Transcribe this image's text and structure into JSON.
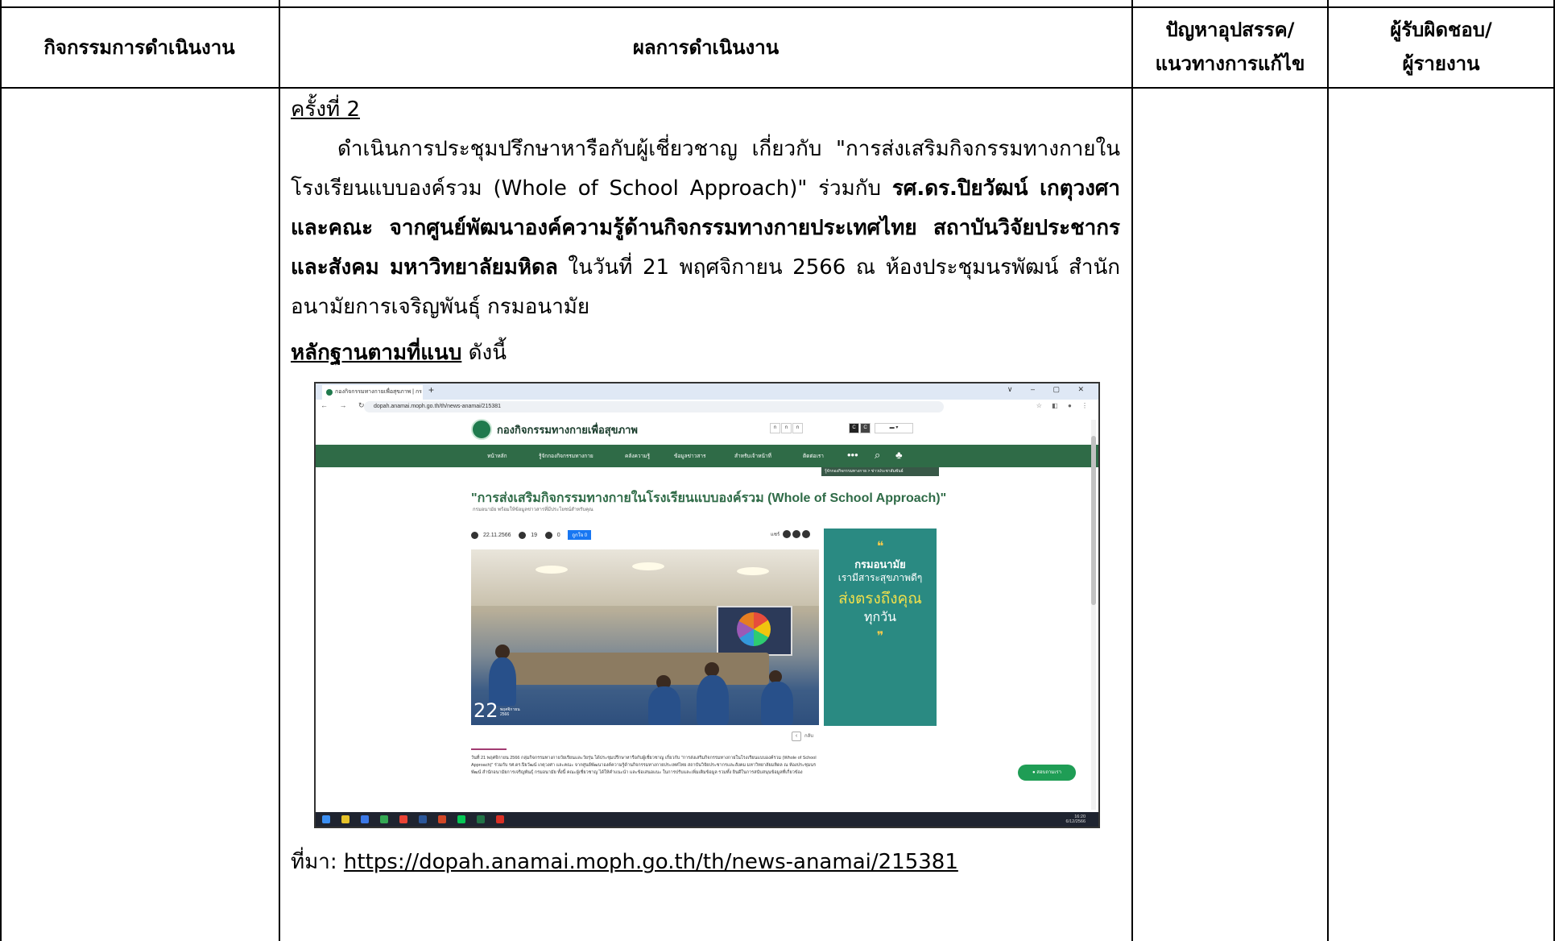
{
  "table": {
    "headers": {
      "activity": "กิจกรรมการดำเนินงาน",
      "results": "ผลการดำเนินงาน",
      "problems_line1": "ปัญหาอุปสรรค/",
      "problems_line2": "แนวทางการแก้ไข",
      "responsible_line1": "ผู้รับผิดชอบ/",
      "responsible_line2": "ผู้รายงาน"
    }
  },
  "content": {
    "session_label": "ครั้งที่ 2",
    "para_part1": "ดำเนินการประชุมปรึกษาหารือกับผู้เชี่ยวชาญ เกี่ยวกับ \"การส่งเสริมกิจกรรมทางกายในโรงเรียนแบบองค์รวม (Whole of School Approach)\" ร่วมกับ ",
    "para_bold": "รศ.ดร.ปิยวัฒน์ เกตุวงศา และคณะ จากศูนย์พัฒนาองค์ความรู้ด้านกิจกรรมทางกายประเทศไทย สถาบันวิจัยประชากรและสังคม มหาวิทยาลัยมหิดล",
    "para_part2": " ในวันที่ 21 พฤศจิกายน 2566 ณ ห้องประชุมนรพัฒน์ สำนักอนามัยการเจริญพันธุ์ กรมอนามัย",
    "evidence_label": "หลักฐานตามที่แนบ",
    "evidence_suffix": " ดังนี้",
    "source_label": "ที่มา: ",
    "source_url": "https://dopah.anamai.moph.go.th/th/news-anamai/215381"
  },
  "screenshot": {
    "tab_title": "กองกิจกรรมทางกายเพื่อสุขภาพ | กร",
    "url": "dopah.anamai.moph.go.th/th/news-anamai/215381",
    "site_name": "กองกิจกรรมทางกายเพื่อสุขภาพ",
    "nav_items": [
      "หน้าหลัก",
      "รู้จักกองกิจกรรมทางกาย",
      "คลังความรู้",
      "ข้อมูลข่าวสาร",
      "สำหรับเจ้าหน้าที่",
      "ติดต่อเรา"
    ],
    "breadcrumb": "รู้จักกองกิจกรรมทางกาย > ข่าวประชาสัมพันธ์",
    "headline": "การส่งเสริมกิจกรรมทางกายในโรงเรียนแบบองค์รวม (Whole of School Approach)\"",
    "subline": "กรมอนามัย พร้อมให้ข้อมูลข่าวสารที่มีประโยชน์สำหรับคุณ",
    "post_date": "22.11.2566",
    "views": "19",
    "comments": "0",
    "like_label": "ถูกใจ 0",
    "share_label": "แชร์",
    "photo_day": "22",
    "photo_month": "พฤศจิกายน",
    "photo_year": "2566",
    "quote_org": "กรมอนามัย",
    "quote_line2": "เรามีสาระสุขภาพดีๆ",
    "quote_line3": "ส่งตรงถึงคุณ",
    "quote_line4": "ทุกวัน",
    "back_label": "กลับ",
    "article_text": "วันที่ 21 พฤศจิกายน 2566 กลุ่มกิจกรรมทางกายวัยเรียนและวัยรุ่น ได้ประชุมปรึกษาหารือกับผู้เชี่ยวชาญ เกี่ยวกับ \"การส่งเสริมกิจกรรมทางกายในโรงเรียนแบบองค์รวม (Whole of School Approach)\" ร่วมกับ รศ.ดร.ปิยวัฒน์ เกตุวงศา และคณะ จากศูนย์พัฒนาองค์ความรู้ด้านกิจกรรมทางกายประเทศไทย สถาบันวิจัยประชากรและสังคม มหาวิทยาลัยมหิดล ณ ห้องประชุมนรพัฒน์ สำนักอนามัยการเจริญพันธุ์ กรมอนามัย ทั้งนี้ คณะผู้เชี่ยวชาญ ได้ให้คำแนะนำ และข้อเสนอแนะ ในการปรับและเพิ่มเติมข้อมูล รวมทั้ง ยินดีในการสนับสนุนข้อมูลที่เกี่ยวข้อง",
    "chat_label": "สอบถามเรา",
    "clock_time": "16:20",
    "clock_date": "6/12/2566",
    "colors": {
      "nav_green": "#2f6b47",
      "quote_teal": "#2a8a82"
    }
  }
}
